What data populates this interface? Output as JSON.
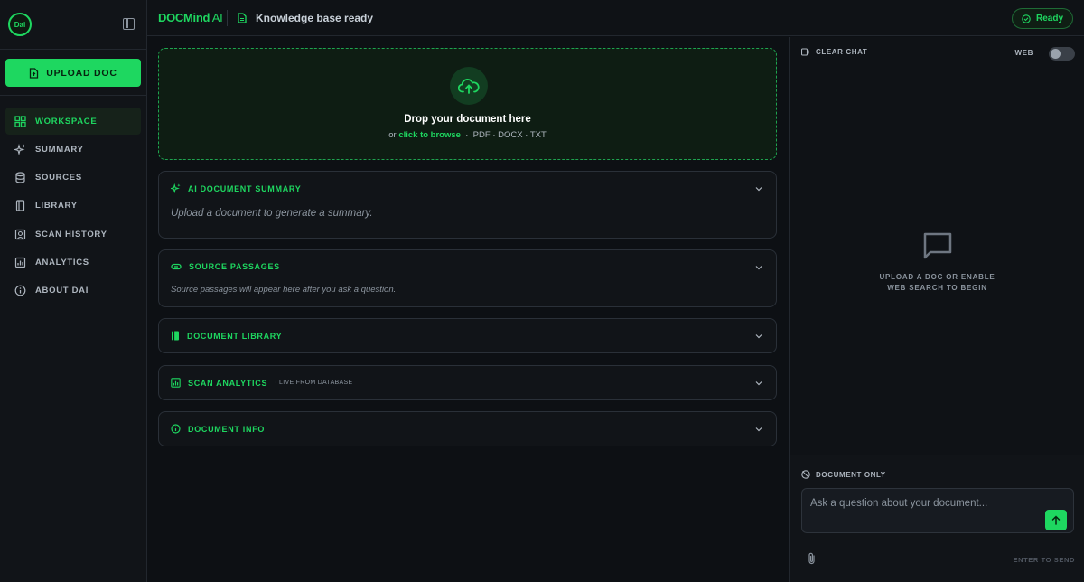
{
  "sidebar": {
    "logo_text": "Dai",
    "upload_label": "UPLOAD DOC",
    "items": [
      {
        "label": "WORKSPACE",
        "icon": "grid-icon",
        "active": true
      },
      {
        "label": "SUMMARY",
        "icon": "sparkle-icon"
      },
      {
        "label": "SOURCES",
        "icon": "database-icon"
      },
      {
        "label": "LIBRARY",
        "icon": "book-icon"
      },
      {
        "label": "SCAN HISTORY",
        "icon": "history-icon"
      },
      {
        "label": "ANALYTICS",
        "icon": "bar-chart-icon"
      },
      {
        "label": "ABOUT DAI",
        "icon": "info-icon"
      }
    ]
  },
  "header": {
    "brand_main": "DOCMind",
    "brand_ai": " AI",
    "status_text": "Knowledge base ready",
    "ready_label": "Ready"
  },
  "dropzone": {
    "title": "Drop your document here",
    "prefix": "or ",
    "link": "click to browse",
    "formats": "  ·  PDF · DOCX · TXT"
  },
  "panels": {
    "summary": {
      "title": "AI DOCUMENT SUMMARY",
      "body": "Upload a document to generate a summary."
    },
    "sources": {
      "title": "SOURCE PASSAGES",
      "body": "Source passages will appear here after you ask a question."
    },
    "library": {
      "title": "DOCUMENT LIBRARY"
    },
    "analytics": {
      "title": "SCAN ANALYTICS",
      "subtitle": "· LIVE FROM DATABASE"
    },
    "info": {
      "title": "DOCUMENT INFO"
    }
  },
  "chat": {
    "clear_label": "CLEAR CHAT",
    "web_label": "WEB",
    "web_enabled": false,
    "empty_text": "UPLOAD A DOC OR ENABLE\nWEB SEARCH TO BEGIN",
    "mode_label": "DOCUMENT ONLY",
    "input_placeholder": "Ask a question about your document...",
    "input_value": "",
    "enter_hint": "ENTER TO SEND"
  },
  "colors": {
    "accent": "#1ed760",
    "background": "#0d1014",
    "panel": "#111418"
  }
}
